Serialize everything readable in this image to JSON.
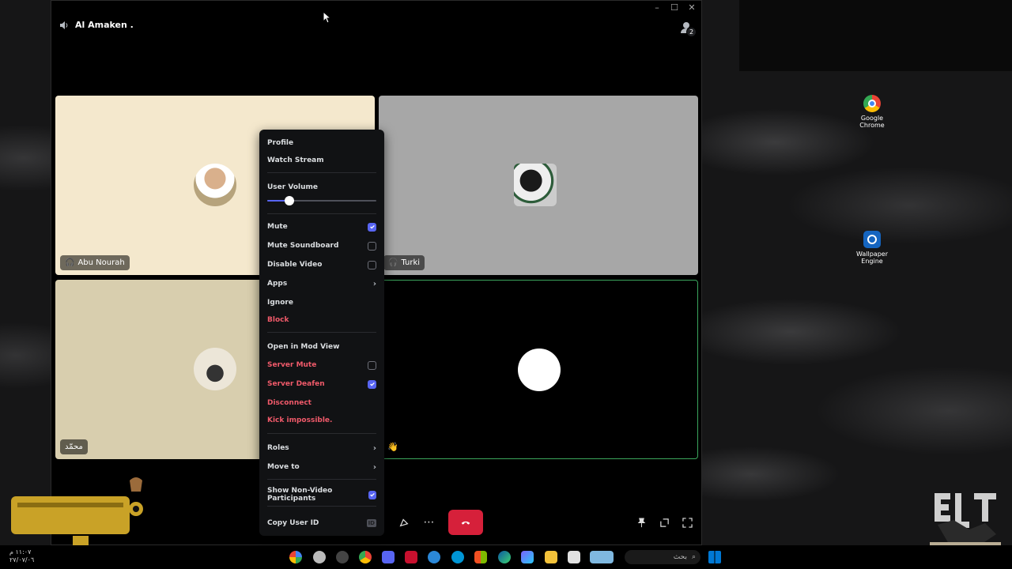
{
  "channel": {
    "name": "Al Amaken ."
  },
  "activity_badge": "2",
  "participants": [
    {
      "name": "Abu Nourah",
      "bg": "#f4e8cd"
    },
    {
      "name": "Turki",
      "bg": "#a7a7a7"
    },
    {
      "name": "محمّد",
      "bg": "#d8ceae"
    },
    {
      "name": "",
      "bg": "#000000"
    }
  ],
  "menu": {
    "profile": "Profile",
    "watch_stream": "Watch Stream",
    "user_volume": "User Volume",
    "volume_level": 0.2,
    "mute": {
      "label": "Mute",
      "checked": true
    },
    "mute_soundboard": {
      "label": "Mute Soundboard",
      "checked": false
    },
    "disable_video": {
      "label": "Disable Video",
      "checked": false
    },
    "apps": "Apps",
    "ignore": "Ignore",
    "block": "Block",
    "open_mod_view": "Open in Mod View",
    "server_mute": {
      "label": "Server Mute",
      "checked": false
    },
    "server_deafen": {
      "label": "Server Deafen",
      "checked": true
    },
    "disconnect": "Disconnect",
    "kick": "Kick impossible.",
    "roles": "Roles",
    "move_to": "Move to",
    "show_non_video": {
      "label": "Show Non-Video Participants",
      "checked": true
    },
    "copy_user_id": "Copy User ID",
    "id_badge": "ID"
  },
  "desktop_icons": [
    {
      "label_1": "Google",
      "label_2": "Chrome"
    },
    {
      "label_1": "Wallpaper",
      "label_2": "Engine"
    }
  ],
  "taskbar": {
    "search_placeholder": "بحث"
  },
  "clock": {
    "time": "١١:٠٧ م",
    "date": "٢٧/٠٧/٠٦"
  },
  "colors": {
    "accent": "#5865f2",
    "danger": "#f05a6a",
    "end_call": "#d6203a"
  }
}
